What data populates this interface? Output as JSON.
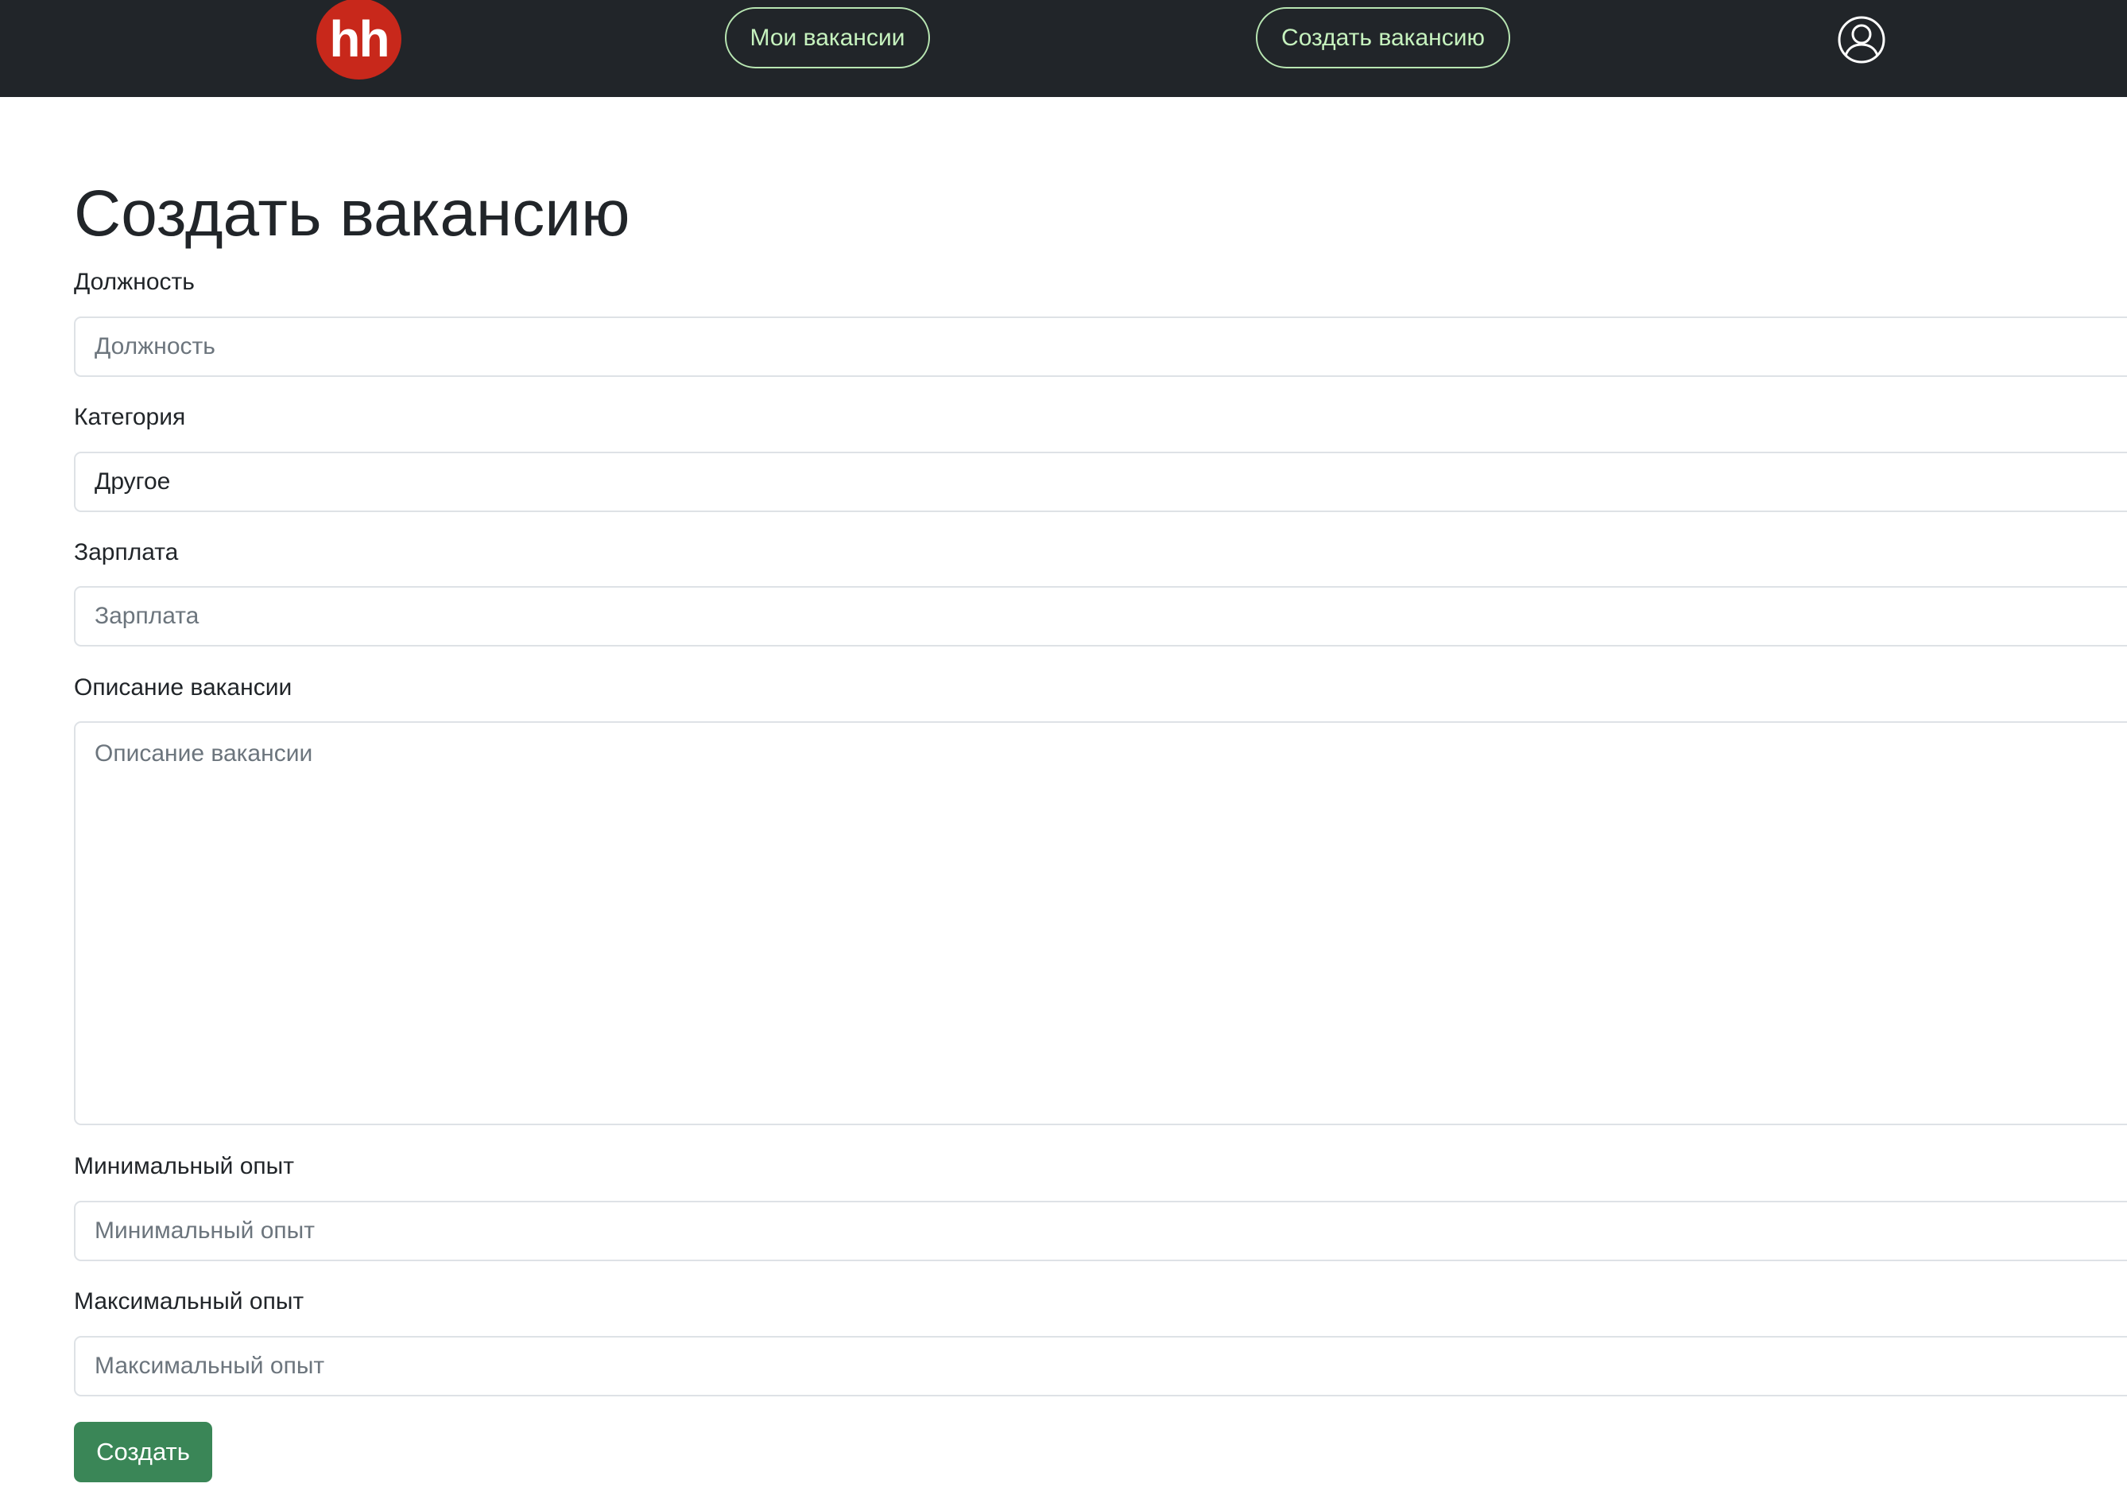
{
  "header": {
    "logo_text": "hh",
    "nav": {
      "my_vacancies": "Мои вакансии",
      "create_vacancy": "Создать вакансию"
    },
    "profile_icon": "user-circle-icon"
  },
  "page": {
    "title": "Создать вакансию"
  },
  "form": {
    "position": {
      "label": "Должность",
      "placeholder": "Должность",
      "value": ""
    },
    "category": {
      "label": "Категория",
      "selected": "Другое",
      "icon": "chevron-down-icon"
    },
    "salary": {
      "label": "Зарплата",
      "placeholder": "Зарплата",
      "value": ""
    },
    "description": {
      "label": "Описание вакансии",
      "placeholder": "Описание вакансии",
      "value": ""
    },
    "min_experience": {
      "label": "Минимальный опыт",
      "placeholder": "Минимальный опыт",
      "value": ""
    },
    "max_experience": {
      "label": "Максимальный опыт",
      "placeholder": "Максимальный опыт",
      "value": ""
    },
    "submit_label": "Создать"
  },
  "colors": {
    "navbar_bg": "#212529",
    "logo_red": "#c8281b",
    "nav_pill_green": "#c6f2be",
    "submit_green": "#3a8657"
  }
}
